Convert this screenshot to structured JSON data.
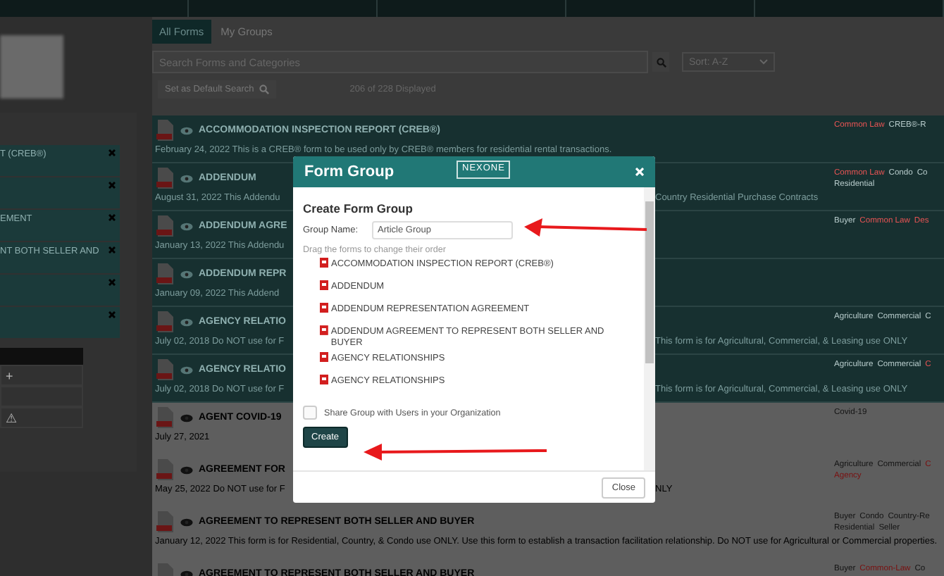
{
  "sidebar": {
    "items": [
      {
        "label": "T (CREB®)",
        "selected": true
      },
      {
        "selected": true
      },
      {
        "label": "EMENT",
        "selected": true
      },
      {
        "label": "NT BOTH SELLER AND",
        "selected": true
      },
      {
        "selected": true
      },
      {
        "selected": true
      }
    ],
    "tools": [
      {
        "kind": "glyph",
        "glyph": "+"
      },
      {
        "kind": "blank"
      },
      {
        "kind": "glyph",
        "glyph": "⚠"
      }
    ]
  },
  "tabs": [
    {
      "label": "All Forms",
      "selected": true
    },
    {
      "label": "My Groups",
      "selected": false
    }
  ],
  "search": {
    "placeholder": "Search Forms and Categories"
  },
  "sort": {
    "value": "Sort: A-Z"
  },
  "default_search_button": "Set as Default Search",
  "count": "206 of 228 Displayed",
  "forms": [
    {
      "title": "ACCOMMODATION INSPECTION REPORT (CREB®)",
      "desc": "February 24, 2022   This is a CREB® form to be used only by CREB® members for residential rental transactions.",
      "selected": true,
      "tags": [
        {
          "label": "Common Law",
          "color": "#e85454"
        },
        {
          "label": "CREB®-R",
          "color": "#b8cccc"
        }
      ]
    },
    {
      "title": "ADDENDUM",
      "desc": "August 31, 2022   This Addendu",
      "desc_tail": "Country Residential Purchase Contracts",
      "selected": true,
      "tags": [
        {
          "label": "Common Law",
          "color": "#e85454"
        },
        {
          "label": "Condo",
          "color": "#b8cccc"
        },
        {
          "label": "Co",
          "color": "#b8cccc"
        },
        {
          "label": "Residential",
          "color": "#b8cccc"
        }
      ]
    },
    {
      "title": "ADDENDUM AGRE",
      "desc": "January 13, 2022   This Addendu",
      "selected": true,
      "tags": [
        {
          "label": "Buyer",
          "color": "#b8cccc"
        },
        {
          "label": "Common Law",
          "color": "#e85454"
        },
        {
          "label": "Des",
          "color": "#e85454"
        }
      ]
    },
    {
      "title": "ADDENDUM REPR",
      "desc": "January 09, 2022   This Addend",
      "selected": true
    },
    {
      "title": "AGENCY RELATIO",
      "desc": "July 02, 2018   Do NOT use for F",
      "desc_tail": "This form is for Agricultural, Commercial, & Leasing use ONLY",
      "selected": true,
      "tags": [
        {
          "label": "Agriculture",
          "color": "#b8cccc"
        },
        {
          "label": "Commercial",
          "color": "#b8cccc"
        },
        {
          "label": "C",
          "color": "#b8cccc"
        }
      ]
    },
    {
      "title": "AGENCY RELATIO",
      "desc": "July 02, 2018   Do NOT use for F",
      "desc_tail": "This form is for Agricultural, Commercial, & Leasing use ONLY",
      "selected": true,
      "tags": [
        {
          "label": "Agriculture",
          "color": "#b8cccc"
        },
        {
          "label": "Commercial",
          "color": "#b8cccc"
        },
        {
          "label": "C",
          "color": "#e85454"
        }
      ]
    },
    {
      "title": "AGENT COVID-19",
      "desc": "July 27, 2021",
      "selected": false,
      "tags": [
        {
          "label": "Covid-19",
          "color": "#141414"
        }
      ]
    },
    {
      "title": "AGREEMENT FOR",
      "desc": "May 25, 2022   Do NOT use for F",
      "desc_tail": "NLY",
      "selected": false,
      "tags": [
        {
          "label": "Agriculture",
          "color": "#141414"
        },
        {
          "label": "Commercial",
          "color": "#141414"
        },
        {
          "label": "C",
          "color": "#7a1010"
        },
        {
          "label": "Agency",
          "color": "#7a1010"
        }
      ]
    },
    {
      "title": "AGREEMENT TO REPRESENT BOTH SELLER AND BUYER",
      "desc": "January 12, 2022   This form is for Residential, Country, & Condo use ONLY. Use this form to establish a transaction facilitation relationship. Do NOT use for Agricultural or Commercial properties.",
      "selected": false,
      "tags": [
        {
          "label": "Buyer",
          "color": "#141414"
        },
        {
          "label": "Condo",
          "color": "#141414"
        },
        {
          "label": "Country-Re",
          "color": "#141414"
        },
        {
          "label": "Residential",
          "color": "#141414"
        },
        {
          "label": "Seller",
          "color": "#141414"
        }
      ]
    },
    {
      "title": "AGREEMENT TO REPRESENT BOTH SELLER AND BUYER",
      "selected": false,
      "tags": [
        {
          "label": "Buyer",
          "color": "#141414"
        },
        {
          "label": "Common-Law",
          "color": "#7a1010"
        },
        {
          "label": "Co",
          "color": "#141414"
        }
      ]
    }
  ],
  "dialog": {
    "title": "Form Group",
    "logo": "NEXONE",
    "heading": "Create Form Group",
    "group_name": {
      "label": "Group Name:",
      "value": "Article Group"
    },
    "hint": "Drag the forms to change their order",
    "forms": [
      "ACCOMMODATION INSPECTION REPORT (CREB®)",
      "ADDENDUM",
      "ADDENDUM REPRESENTATION AGREEMENT",
      "ADDENDUM AGREEMENT TO REPRESENT BOTH SELLER AND BUYER",
      "AGENCY RELATIONSHIPS",
      "AGENCY RELATIONSHIPS"
    ],
    "share": {
      "label": "Share Group with Users in your Organization",
      "checked": false
    },
    "create_button": "Create",
    "close_button": "Close"
  }
}
